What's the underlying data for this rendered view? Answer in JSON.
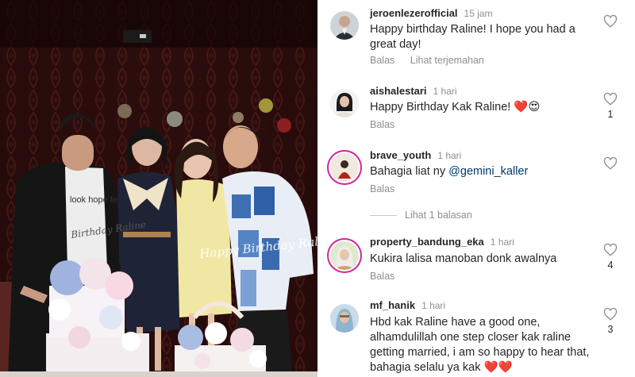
{
  "photo": {
    "overlay_signature": "Happy Birthday Raline",
    "shirt_text": "look hope fear",
    "shirt_signature": "Birthday Raline"
  },
  "comments": [
    {
      "username": "jeroenlezerofficial",
      "time": "15 jam",
      "text": "Happy birthday Raline! I hope you had a great day!",
      "actions": [
        "Balas",
        "Lihat terjemahan"
      ],
      "likes": "",
      "avatar": "man-in-suit-avatar"
    },
    {
      "username": "aishalestari",
      "time": "1 hari",
      "text": "Happy Birthday Kak Raline! ❤️😍",
      "actions": [
        "Balas"
      ],
      "likes": "1",
      "avatar": "woman-avatar"
    },
    {
      "username": "brave_youth",
      "time": "1 hari",
      "text_prefix": "Bahagia liat ny ",
      "mention": "@gemini_kaller",
      "actions": [
        "Balas"
      ],
      "likes": "",
      "avatar": "person-red-avatar"
    },
    {
      "username": "property_bandung_eka",
      "time": "1 hari",
      "text": "Kukira lalisa manoban donk awalnya",
      "actions": [
        "Balas"
      ],
      "likes": "4",
      "avatar": "hijab-woman-avatar"
    },
    {
      "username": "mf_hanik",
      "time": "1 hari",
      "text": "Hbd kak Raline have a good one, alhamdulillah one step closer kak raline getting married, i am so happy to hear that, bahagia selalu ya kak ❤️❤️",
      "actions": [],
      "likes": "3",
      "avatar": "hijab-woman-2-avatar"
    }
  ],
  "view_replies": "Lihat 1 balasan",
  "colors": {
    "heart_red": "#ed4956",
    "mention_blue": "#00376b",
    "muted": "#8e8e8e"
  }
}
